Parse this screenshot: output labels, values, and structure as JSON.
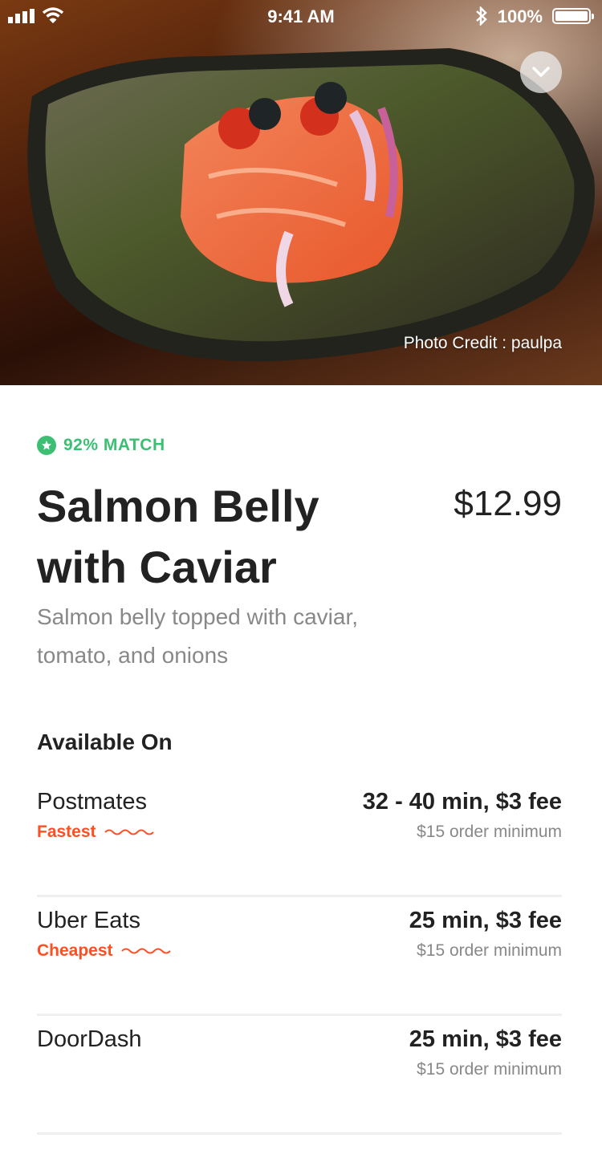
{
  "status_bar": {
    "time": "9:41 AM",
    "battery": "100%"
  },
  "hero": {
    "photo_credit": "Photo Credit : paulpa"
  },
  "item": {
    "match": "92% MATCH",
    "title_line1": "Salmon Belly",
    "title_line2": "with Caviar",
    "price": "$12.99",
    "description": "Salmon belly topped with caviar, tomato, and onions"
  },
  "available_on": {
    "heading": "Available On",
    "services": [
      {
        "name": "Postmates",
        "tag": "Fastest",
        "eta": "32 - 40 min, $3 fee",
        "minimum": "$15 order minimum"
      },
      {
        "name": "Uber Eats",
        "tag": "Cheapest",
        "eta": "25 min, $3 fee",
        "minimum": "$15 order minimum"
      },
      {
        "name": "DoorDash",
        "tag": "",
        "eta": "25 min, $3 fee",
        "minimum": "$15 order minimum"
      }
    ]
  },
  "colors": {
    "match_green": "#3dbf73",
    "tag_orange": "#ff4e22",
    "muted_text": "#888888"
  },
  "icons": [
    "signal-icon",
    "wifi-icon",
    "bluetooth-icon",
    "battery-icon",
    "chevron-down-icon",
    "star-icon",
    "squiggle-icon"
  ]
}
